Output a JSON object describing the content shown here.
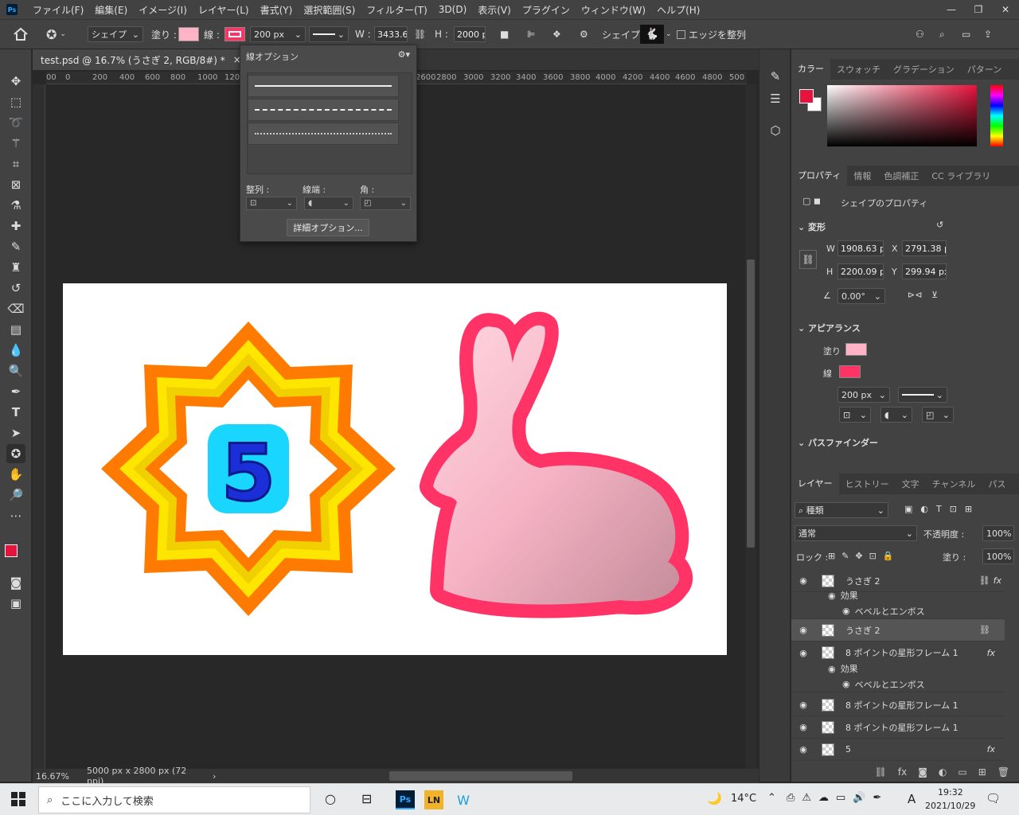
{
  "menubar": {
    "items": [
      "ファイル(F)",
      "編集(E)",
      "イメージ(I)",
      "レイヤー(L)",
      "書式(Y)",
      "選択範囲(S)",
      "フィルター(T)",
      "3D(D)",
      "表示(V)",
      "プラグイン",
      "ウィンドウ(W)",
      "ヘルプ(H)"
    ]
  },
  "options": {
    "shape_mode": "シェイプ",
    "fill_label": "塗り :",
    "stroke_label": "線 :",
    "stroke_width": "200 px",
    "w_label": "W :",
    "w_value": "3433.6",
    "h_label": "H :",
    "h_value": "2000 p",
    "shape_label": "シェイプ :",
    "align_edges": "エッジを整列",
    "fill_color": "#ffb3c6",
    "stroke_color": "#ff3366"
  },
  "document": {
    "tab_title": "test.psd @ 16.7% (うさぎ 2, RGB/8#) *",
    "zoom": "16.67%",
    "doc_size": "5000 px x 2800 px (72 ppi)",
    "ruler_ticks": [
      "00",
      "0",
      "200",
      "400",
      "600",
      "800",
      "1000",
      "120",
      "2600",
      "2800",
      "3000",
      "3200",
      "3400",
      "3600",
      "3800",
      "4000",
      "4200",
      "4400",
      "4600",
      "4800",
      "500"
    ]
  },
  "stroke_popup": {
    "title": "線オプション",
    "align_label": "整列 :",
    "caps_label": "線端 :",
    "corners_label": "角 :",
    "more_button": "詳細オプション..."
  },
  "color_panel": {
    "tabs": [
      "カラー",
      "スウォッチ",
      "グラデーション",
      "パターン"
    ],
    "foreground": "#e8133c"
  },
  "properties": {
    "tabs": [
      "プロパティ",
      "情報",
      "色調補正",
      "CC ライブラリ"
    ],
    "header": "シェイプのプロパティ",
    "transform_title": "変形",
    "w_label": "W",
    "w": "1908.63 p",
    "x_label": "X",
    "x": "2791.38 p",
    "h_label": "H",
    "h": "2200.09 p",
    "y_label": "Y",
    "y": "299.94 px",
    "angle": "0.00°",
    "appearance_title": "アピアランス",
    "fill_label": "塗り",
    "stroke_label": "線",
    "stroke_width": "200 px",
    "pathfinder_title": "パスファインダー"
  },
  "layers_panel": {
    "tabs": [
      "レイヤー",
      "ヒストリー",
      "文字",
      "チャンネル",
      "パス",
      "段落"
    ],
    "filter": "種類",
    "blend_mode": "通常",
    "opacity_label": "不透明度 :",
    "opacity": "100%",
    "lock_label": "ロック :",
    "fill_label": "塗り :",
    "fill": "100%",
    "layers": [
      {
        "name": "うさぎ 2",
        "fx": "fx"
      },
      {
        "name": "効果"
      },
      {
        "name": "ベベルとエンボス"
      },
      {
        "name": "うさぎ 2"
      },
      {
        "name": "8 ポイントの星形フレーム 1",
        "fx": "fx"
      },
      {
        "name": "効果"
      },
      {
        "name": "ベベルとエンボス"
      },
      {
        "name": "8 ポイントの星形フレーム 1"
      },
      {
        "name": "8 ポイントの星形フレーム 1"
      },
      {
        "name": "5",
        "fx": "fx"
      }
    ]
  },
  "taskbar": {
    "search_placeholder": "ここに入力して検索",
    "temperature": "14°C",
    "ime": "A",
    "time": "19:32",
    "date": "2021/10/29",
    "apps": [
      "Ps",
      "LN",
      "W"
    ]
  }
}
